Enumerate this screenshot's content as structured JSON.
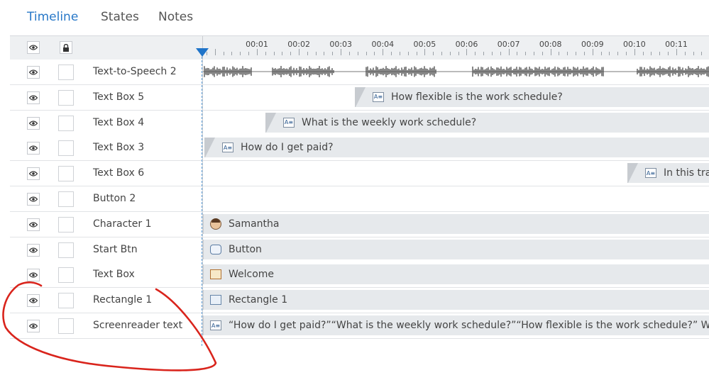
{
  "tabs": [
    {
      "label": "Timeline",
      "active": true
    },
    {
      "label": "States",
      "active": false
    },
    {
      "label": "Notes",
      "active": false
    }
  ],
  "header": {
    "eye_icon": "eye-icon",
    "lock_icon": "lock-icon",
    "ruler_labels": [
      "00:01",
      "00:02",
      "00:03",
      "00:04",
      "00:05",
      "00:06",
      "00:07",
      "00:08",
      "00:09",
      "00:10",
      "00:11",
      "00:1"
    ]
  },
  "rows": [
    {
      "name": "Text-to-Speech 2",
      "bar_type": "audio"
    },
    {
      "name": "Text Box 5",
      "bar_text": "How flexible is the work schedule?",
      "icon": "text-box-icon"
    },
    {
      "name": "Text Box 4",
      "bar_text": "What is the weekly work schedule?",
      "icon": "text-box-icon"
    },
    {
      "name": "Text Box 3",
      "bar_text": "How do I get paid?",
      "icon": "text-box-icon"
    },
    {
      "name": "Text Box 6",
      "bar_text": "In this tra",
      "icon": "text-box-icon"
    },
    {
      "name": "Button 2",
      "bar_text": ""
    },
    {
      "name": "Character 1",
      "bar_text": "Samantha",
      "icon": "character-icon"
    },
    {
      "name": "Start Btn",
      "bar_text": "Button",
      "icon": "button-icon"
    },
    {
      "name": "Text Box",
      "bar_text": "Welcome",
      "icon": "welcome-icon"
    },
    {
      "name": "Rectangle 1",
      "bar_text": "Rectangle 1",
      "icon": "rectangle-icon"
    },
    {
      "name": "Screenreader text",
      "bar_text": "“How do I get paid?”“What is the weekly work schedule?”“How flexible is the work schedule?” Welcome",
      "icon": "text-box-icon"
    }
  ],
  "colors": {
    "accent": "#2878c8",
    "playhead": "#1f74c9",
    "annotation": "#d9241c"
  }
}
